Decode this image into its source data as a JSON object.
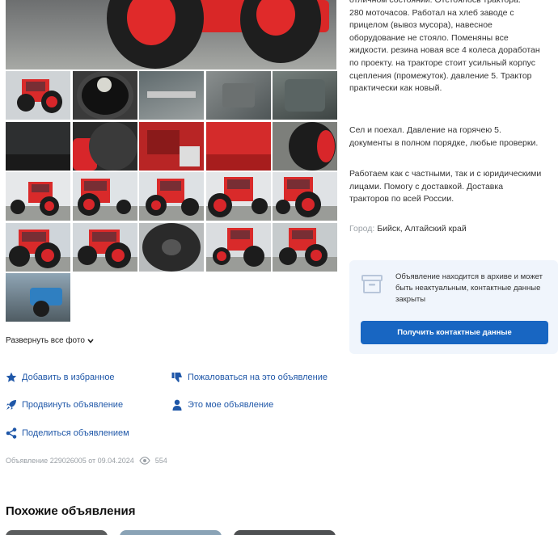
{
  "description": {
    "top_cut": "отличном состоянии. Отстоялось трактора.",
    "paragraph1": [
      "280 моточасов. Работал на хлеб заводе с",
      "прицелом (вывоз мусора), навесное",
      "оборудование не стояло. Поменяны все",
      "жидкости. резина новая все 4 колеса доработан",
      "по проекту. на тракторе стоит усильный корпус",
      "сцепления (промежуток). давление 5. Трактор",
      "практически как новый."
    ],
    "paragraph2": [
      "Сел и поехал. Давление на горячею 5.",
      "документы в полном порядке, любые проверки."
    ],
    "paragraph3": [
      "Работаем как с частными, так и с юридическими",
      "лицами. Помогу с доставкой. Доставка",
      "тракторов по всей России."
    ]
  },
  "city": {
    "label": "Город:",
    "value": "Бийск, Алтайский край"
  },
  "archive": {
    "icon": "archive-box-icon",
    "note": "Объявление находится в архиве и может быть неактуальным, контактные данные закрыты",
    "button_label": "Получить контактные данные"
  },
  "gallery": {
    "expand_label": "Развернуть все фото",
    "expand_icon": "chevron-down-icon"
  },
  "actions": {
    "favorite": {
      "label": "Добавить в избранное",
      "icon": "star-icon"
    },
    "report": {
      "label": "Пожаловаться на это объявление",
      "icon": "thumbs-down-icon"
    },
    "promote": {
      "label": "Продвинуть объявление",
      "icon": "rocket-icon"
    },
    "mine": {
      "label": "Это мое объявление",
      "icon": "user-icon"
    },
    "share": {
      "label": "Поделиться объявлением",
      "icon": "share-icon"
    }
  },
  "listing_meta": {
    "id_text": "Объявление 229026005 от 09.04.2024",
    "views": "554"
  },
  "similar": {
    "title": "Похожие объявления"
  },
  "colors": {
    "accent": "#1f57a8",
    "button": "#1866c2",
    "archive_bg": "#f0f5fc",
    "tractor_red": "#d92727"
  }
}
